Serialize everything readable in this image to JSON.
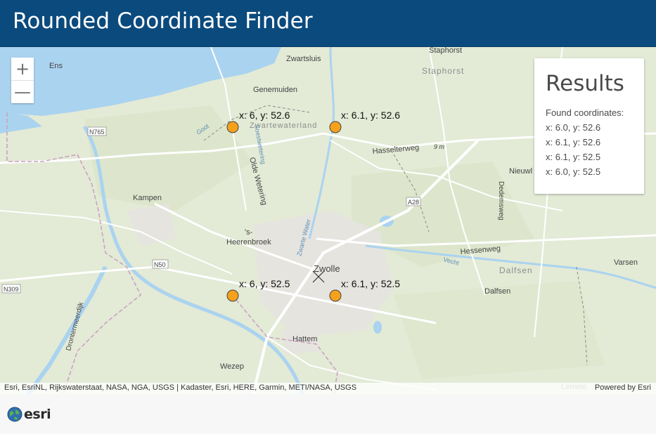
{
  "header": {
    "title": "Rounded Coordinate Finder"
  },
  "zoom": {
    "in_label": "+",
    "out_label": "—"
  },
  "results": {
    "title": "Results",
    "found_label": "Found coordinates:",
    "items": [
      "x: 6.0, y: 52.6",
      "x: 6.1, y: 52.6",
      "x: 6.1, y: 52.5",
      "x: 6.0, y: 52.5"
    ]
  },
  "map": {
    "place_labels": [
      "Ens",
      "Zwartsluis",
      "Staphorst",
      "Staphorst",
      "Genemuiden",
      "Zwartewaterland",
      "N765",
      "Hasselterweg",
      "Nieuwl",
      "Kampen",
      "Olde Wetering",
      "A28",
      "'s-",
      "Heerenbroek",
      "Dedemsweg",
      "Hessenweg",
      "N50",
      "Zwolle",
      "Dalfsen",
      "Dalfsen",
      "Varsen",
      "N309",
      "Drontermeerdijk",
      "Hattem",
      "Wezep",
      "Lemele",
      "Zwarte Water",
      "Vecht",
      "Goot",
      "9 m",
      "Soestwetering"
    ],
    "point_labels": [
      "x: 6, y: 52.6",
      "x: 6.1, y: 52.6",
      "x: 6, y: 52.5",
      "x: 6.1, y: 52.5"
    ],
    "point_color": "#f5a11c",
    "water_color": "#aad3f0",
    "land_color": "#e3ead6"
  },
  "attribution": {
    "left": "Esri, EsriNL, Rijkswaterstaat, NASA, NGA, USGS | Kadaster, Esri, HERE, Garmin, METI/NASA, USGS",
    "right": "Powered by Esri"
  },
  "footer": {
    "logo_text": "esri"
  }
}
